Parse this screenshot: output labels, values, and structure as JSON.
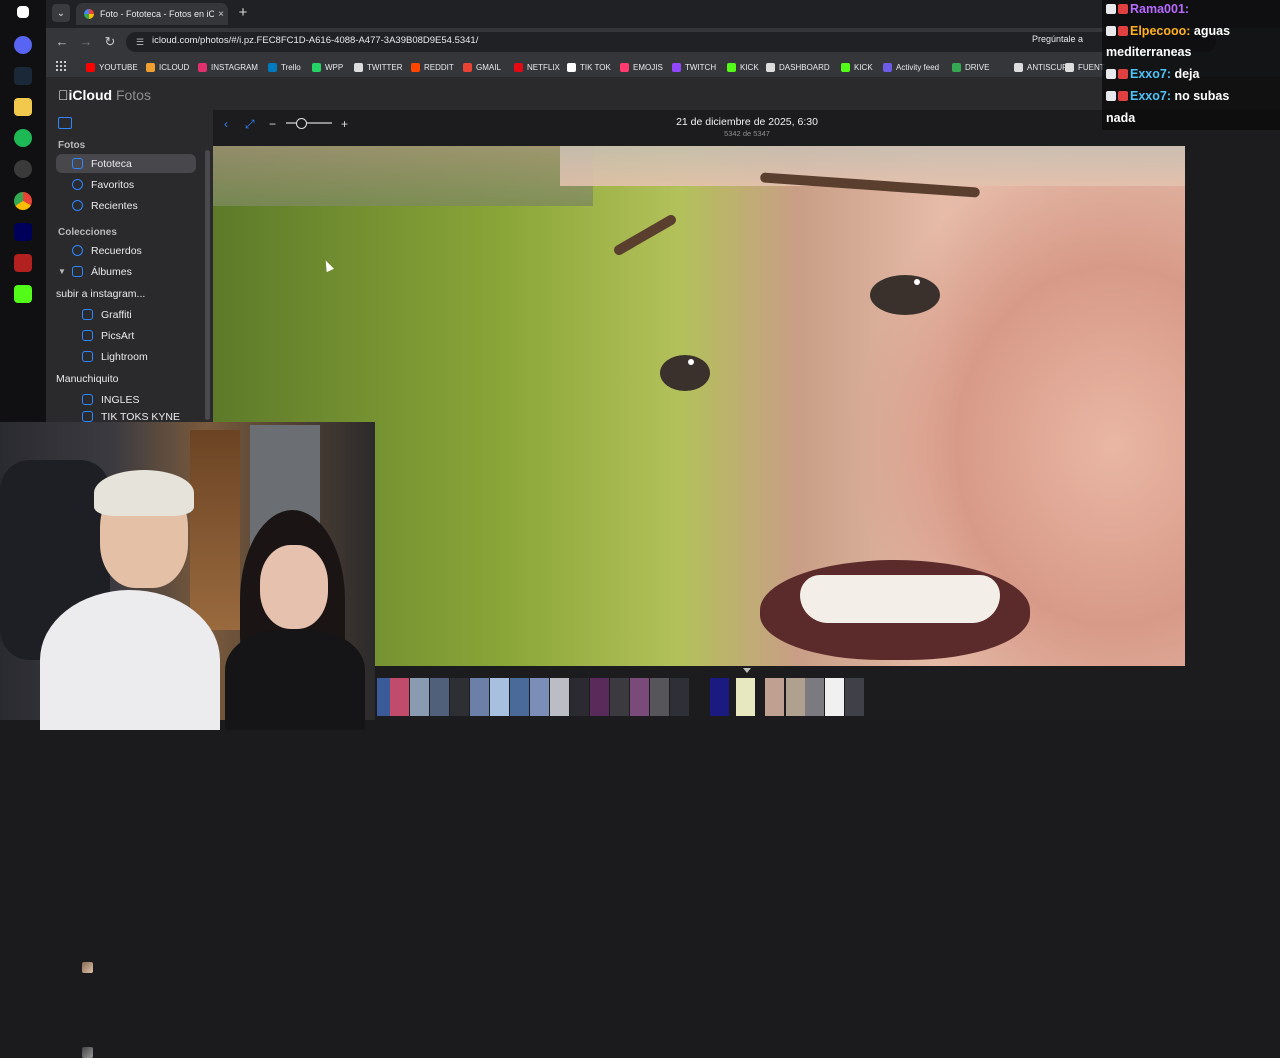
{
  "browser": {
    "tab_title": "Foto - Fototeca - Fotos en iCloud",
    "tab_close": "×",
    "new_tab": "+",
    "url": "icloud.com/photos/#/i.pz.FEC8FC1D-A616-4088-A477-3A39B08D9E54.5341/",
    "ask_button": "Pregúntale a",
    "bookmarks": [
      "YOUTUBE",
      "ICLOUD",
      "INSTAGRAM",
      "Trello",
      "WPP",
      "TWITTER",
      "REDDIT",
      "GMAIL",
      "NETFLIX",
      "TIK TOK",
      "EMOJIS",
      "TWITCH",
      "KICK",
      "DASHBOARD",
      "KICK",
      "Activity feed",
      "DRIVE",
      "ANTISCUFF",
      "FUENT"
    ],
    "bookmark_colors": [
      "#ff0000",
      "#f0a030",
      "#e1306c",
      "#0079bf",
      "#25d366",
      "#dddddd",
      "#ff4500",
      "#ea4335",
      "#e50914",
      "#ffffff",
      "#ff3a6e",
      "#9146ff",
      "#53fc18",
      "#dddddd",
      "#53fc18",
      "#6c5ce7",
      "#34a853",
      "#dddddd",
      "#dddddd"
    ]
  },
  "app": {
    "logo_brand": "iCloud",
    "logo_product": "Fotos",
    "sidebar": {
      "section_fotos": "Fotos",
      "fotos_items": [
        "Fototeca",
        "Favoritos",
        "Recientes"
      ],
      "section_colecciones": "Colecciones",
      "colecciones_items": [
        "Recuerdos",
        "Álbumes"
      ],
      "albums": [
        "subir a instagram...",
        "Graffiti",
        "PicsArt",
        "Lightroom",
        "Manuchiquito",
        "INGLES",
        "TIK TOKS KYNE"
      ]
    },
    "viewer": {
      "date": "21 de diciembre de 2025, 6:30",
      "counter": "5342 de 5347",
      "zoom_out": "−",
      "zoom_in": "+",
      "zoom_level": 0.3
    }
  },
  "chat": {
    "messages": [
      {
        "user": "Rama001:",
        "text": "",
        "color": "#b86bff"
      },
      {
        "user": "Elpecooo:",
        "text": "aguas",
        "color": "#ffb020"
      },
      {
        "user": "",
        "text": "mediterraneas",
        "color": "#ffffff"
      },
      {
        "user": "Exxo7:",
        "text": "deja",
        "color": "#4fc3f7"
      },
      {
        "user": "Exxo7:",
        "text": "no subas",
        "color": "#4fc3f7"
      },
      {
        "user": "",
        "text": "nada",
        "color": "#ffffff"
      }
    ]
  },
  "colors": {
    "accent": "#2f86ff",
    "sidebar_bg": "#2a2a2c",
    "viewer_bg": "#1c1c1e"
  }
}
